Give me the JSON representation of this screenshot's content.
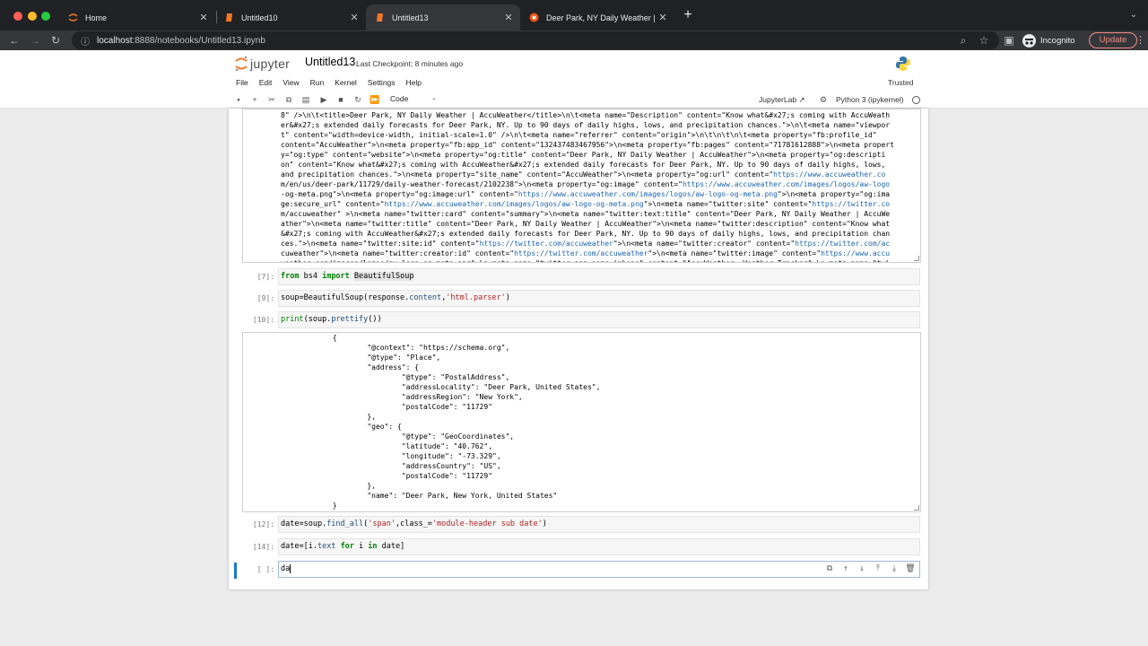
{
  "browser": {
    "tabs": [
      {
        "label": "Home",
        "icon": "jupyter-icon",
        "active": false
      },
      {
        "label": "Untitled10",
        "icon": "notebook-icon",
        "active": false
      },
      {
        "label": "Untitled13",
        "icon": "notebook-icon",
        "active": true
      },
      {
        "label": "Deer Park, NY Daily Weather | Ac",
        "icon": "accuweather-icon",
        "active": false
      }
    ],
    "url_host": "localhost",
    "url_rest": ":8888/notebooks/Untitled13.ipynb",
    "profile_label": "Incognito",
    "update_label": "Update",
    "update_color": "#f28b82"
  },
  "jupyter": {
    "logo_text": "jupyter",
    "notebook_name": "Untitled13",
    "checkpoint": "Last Checkpoint: 8 minutes ago",
    "trusted": "Trusted",
    "menus": [
      "File",
      "Edit",
      "View",
      "Run",
      "Kernel",
      "Settings",
      "Help"
    ],
    "cell_type": "Code",
    "jupyterlab_label": "JupyterLab",
    "kernel_label": "Python 3 (ipykernel)"
  },
  "cells": {
    "output1_lines": [
      "8\" />\\n\\t<title>Deer Park, NY Daily Weather | AccuWeather</title>\\n\\t<meta name=\"Description\" content=\"Know what&#x27;s coming with AccuWeath",
      "er&#x27;s extended daily forecasts for Deer Park, NY. Up to 90 days of daily highs, lows, and precipitation chances.\">\\n\\t<meta name=\"viewpor",
      "t\" content=\"width=device-width, initial-scale=1.0\" />\\n\\t<meta name=\"referrer\" content=\"origin\">\\n\\t\\n\\t\\n\\t<meta property=\"fb:profile_id\"",
      "content=\"AccuWeather\">\\n<meta property=\"fb:app_id\" content=\"132437483467956\">\\n<meta property=\"fb:pages\" content=\"71781612888\">\\n<meta propert",
      "y=\"og:type\" content=\"website\">\\n<meta property=\"og:title\" content=\"Deer Park, NY Daily Weather | AccuWeather\">\\n<meta property=\"og:descripti",
      "on\" content=\"Know what&#x27;s coming with AccuWeather&#x27;s extended daily forecasts for Deer Park, NY. Up to 90 days of daily highs, lows,",
      "and precipitation chances.\">\\n<meta property=\"site_name\" content=\"AccuWeather\">\\n<meta property=\"og:url\" content=\"https://www.accuweather.co",
      "m/en/us/deer-park/11729/daily-weather-forecast/2102238\">\\n<meta property=\"og:image\" content=\"https://www.accuweather.com/images/logos/aw-logo",
      "-og-meta.png\">\\n<meta property=\"og:image:url\" content=\"https://www.accuweather.com/images/logos/aw-logo-og-meta.png\">\\n<meta property=\"og:ima",
      "ge:secure_url\" content=\"https://www.accuweather.com/images/logos/aw-logo-og-meta.png\">\\n<meta name=\"twitter:site\" content=\"https://twitter.co",
      "m/accuweather\" >\\n<meta name=\"twitter:card\" content=\"summary\">\\n<meta name=\"twitter:text:title\" content=\"Deer Park, NY Daily Weather | AccuWe",
      "ather\">\\n<meta name=\"twitter:title\" content=\"Deer Park, NY Daily Weather | AccuWeather\">\\n<meta name=\"twitter:description\" content=\"Know what",
      "&#x27;s coming with AccuWeather&#x27;s extended daily forecasts for Deer Park, NY. Up to 90 days of daily highs, lows, and precipitation chan",
      "ces.\">\\n<meta name=\"twitter:site:id\" content=\"https://twitter.com/accuweather\">\\n<meta name=\"twitter:creator\" content=\"https://twitter.com/ac",
      "cuweather\">\\n<meta name=\"twitter:creator:id\" content=\"https://twitter.com/accuweather\">\\n<meta name=\"twitter:image\" content=\"https://www.accu",
      "weather.com/images/logos/aw-logo-og-meta.png\">\\n<meta name=\"twitter:app:name:iphone\" content=\"AccuWeather: Weather Tracker\">\\n<meta name=\"twi"
    ],
    "c7": {
      "prompt": "[7]:"
    },
    "c9": {
      "prompt": "[9]:"
    },
    "c10": {
      "prompt": "[10]:"
    },
    "c12": {
      "prompt": "[12]:"
    },
    "c14": {
      "prompt": "[14]:"
    },
    "active": {
      "prompt": "[ ]:",
      "value": "da"
    },
    "output2_lines": [
      "            {",
      "                    \"@context\": \"https://schema.org\",",
      "                    \"@type\": \"Place\",",
      "                    \"address\": {",
      "                            \"@type\": \"PostalAddress\",",
      "                            \"addressLocality\": \"Deer Park, United States\",",
      "                            \"addressRegion\": \"New York\",",
      "                            \"postalCode\": \"11729\"",
      "                    },",
      "                    \"geo\": {",
      "                            \"@type\": \"GeoCoordinates\",",
      "                            \"latitude\": \"40.762\",",
      "                            \"longitude\": \"-73.329\",",
      "                            \"addressCountry\": \"US\",",
      "                            \"postalCode\": \"11729\"",
      "                    },",
      "                    \"name\": \"Deer Park, New York, United States\"",
      "            }"
    ]
  }
}
